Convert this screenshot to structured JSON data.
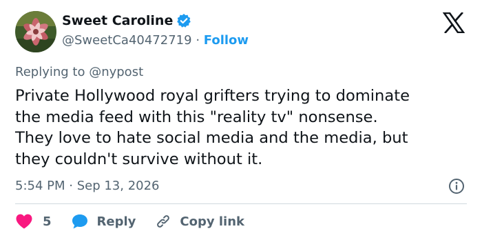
{
  "author": {
    "display_name": "Sweet Caroline",
    "handle": "@SweetCa40472719",
    "separator": "·",
    "follow_label": "Follow",
    "verified_icon": "verified-badge-icon",
    "avatar_icon": "flower-photo-avatar"
  },
  "brand": {
    "logo_icon": "x-logo-icon"
  },
  "tweet": {
    "replying_to": "Replying to @nypost",
    "lines": [
      "Private Hollywood royal grifters trying to dominate",
      "the media feed with this \"reality tv\" nonsense.",
      "They love to hate social media and the media, but",
      "they couldn't survive without it."
    ],
    "timestamp": "5:54 PM · Sep 13, 2026",
    "info_icon": "info-icon"
  },
  "actions": {
    "like_count": "5",
    "reply_label": "Reply",
    "copy_link_label": "Copy link"
  },
  "colors": {
    "accent": "#1d9bf0",
    "like": "#f91880",
    "text": "#0f1419",
    "muted": "#536471",
    "divider": "#cfd9de"
  }
}
